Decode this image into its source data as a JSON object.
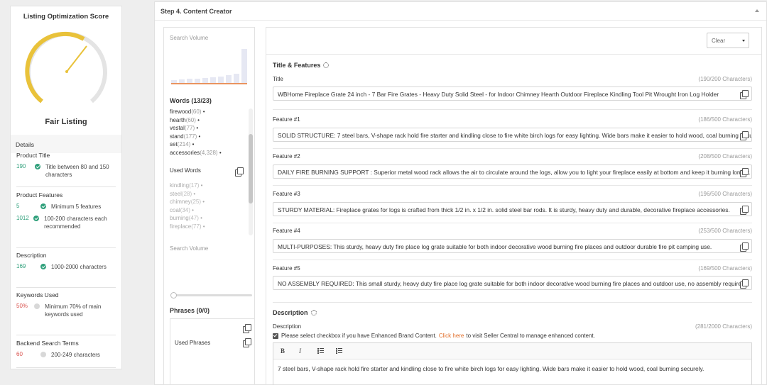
{
  "score_panel": {
    "title": "Listing Optimization Score",
    "status": "Fair Listing",
    "gauge_score_fraction": 0.38,
    "details_label": "Details",
    "criteria": [
      {
        "title": "Product Title",
        "rows": [
          {
            "value": "190",
            "value_color": "green",
            "check": "ok",
            "text": "Title between 80 and 150 characters"
          }
        ]
      },
      {
        "title": "Product Features",
        "rows": [
          {
            "value": "5",
            "value_color": "green",
            "check": "ok",
            "text": "Minimum 5 features"
          },
          {
            "value": "1012",
            "value_color": "green",
            "check": "ok",
            "text": "100-200 characters each recommended"
          }
        ]
      },
      {
        "title": "Description",
        "rows": [
          {
            "value": "169",
            "value_color": "green",
            "check": "ok",
            "text": "1000-2000 characters"
          }
        ]
      },
      {
        "title": "Keywords Used",
        "rows": [
          {
            "value": "50%",
            "value_color": "red",
            "check": "no",
            "text": "Minimum 70% of main keywords used"
          }
        ]
      },
      {
        "title": "Backend Search Terms",
        "rows": [
          {
            "value": "60",
            "value_color": "red",
            "check": "no",
            "text": "200-249 characters"
          }
        ]
      }
    ]
  },
  "main": {
    "step_title": "Step 4. Content Creator"
  },
  "keywords": {
    "search_volume_label": "Search Volume",
    "search_volume_label_2": "Search Volume",
    "words_title": "Words (13/23)",
    "words": [
      {
        "word": "firewood",
        "count": "(60)"
      },
      {
        "word": "hearth",
        "count": "(60)"
      },
      {
        "word": "vestal",
        "count": "(77)"
      },
      {
        "word": "stand",
        "count": "(177)"
      },
      {
        "word": "set",
        "count": "(214)"
      },
      {
        "word": "accessories",
        "count": "(4,328)"
      }
    ],
    "used_words_label": "Used Words",
    "used_words": [
      {
        "word": "kindling",
        "count": "(17)"
      },
      {
        "word": "steel",
        "count": "(28)"
      },
      {
        "word": "chimney",
        "count": "(25)"
      },
      {
        "word": "coal",
        "count": "(34)"
      },
      {
        "word": "burning",
        "count": "(47)"
      },
      {
        "word": "fireplace",
        "count": "(77)"
      }
    ],
    "phrases_title": "Phrases (0/0)",
    "used_phrases_label": "Used Phrases"
  },
  "editor": {
    "clear_label": "Clear",
    "title_features_heading": "Title & Features",
    "fields": [
      {
        "label": "Title",
        "count": "(190/200 Characters)",
        "value": "WBHome Fireplace Grate 24 inch - 7 Bar Fire Grates - Heavy Duty Solid Steel - for Indoor Chimney Hearth Outdoor Fireplace Kindling Tool Pit Wrought Iron Log Holder"
      },
      {
        "label": "Feature #1",
        "count": "(186/500 Characters)",
        "value": "SOLID STRUCTURE: 7 steel bars, V-shape rack hold fire starter and kindling close to fire white birch logs for easy lighting. Wide bars make it easier to hold wood, coal burning securely."
      },
      {
        "label": "Feature #2",
        "count": "(208/500 Characters)",
        "value": "DAILY FIRE BURNING SUPPORT :  Superior metal wood rack allows the air to circulate around the logs, allow you to light your fireplace easily at bottom and keep it burning longer."
      },
      {
        "label": "Feature #3",
        "count": "(196/500 Characters)",
        "value": "STURDY MATERIAL: Fireplace grates for logs is crafted from thick 1/2 in. x 1/2 in. solid steel bar rods. It is sturdy, heavy duty and durable, decorative fireplace accessories."
      },
      {
        "label": "Feature #4",
        "count": "(253/500 Characters)",
        "value": "MULTI-PURPOSES: This sturdy, heavy duty fire place log grate suitable for both indoor decorative wood burning fire places and outdoor durable fire pit camping use."
      },
      {
        "label": "Feature #5",
        "count": "(169/500 Characters)",
        "value": "NO ASSEMBLY REQUIRED: This small sturdy, heavy duty fire place log grate suitable for both indoor decorative wood burning fire places and outdoor use, no assembly required."
      }
    ],
    "description_heading": "Description",
    "description_label": "Description",
    "description_count": "(281/2000 Characters)",
    "checkbox_text": "Please select checkbox if you have Enhanced Brand Content.",
    "checkbox_link": "Click here",
    "checkbox_text_after": "to visit Seller Central to manage enhanced content.",
    "toolbar": {
      "bold": "B",
      "italic": "I"
    },
    "description_text": "7 steel bars, V-shape rack hold fire starter and kindling close to fire white birch logs for easy lighting. Wide bars make it easier to hold wood, coal burning securely."
  },
  "colors": {
    "gauge_yellow": "#e9c23a",
    "gauge_grey": "#e4e4e4",
    "good_green": "#2e9f7a",
    "bad_red": "#d9534f",
    "link_orange": "#e2702c"
  },
  "icons": [
    "gear-icon",
    "copy-icon",
    "chevron-up-icon",
    "dropdown-caret-icon",
    "bullet-list-icon",
    "numbered-list-icon",
    "check-icon"
  ]
}
